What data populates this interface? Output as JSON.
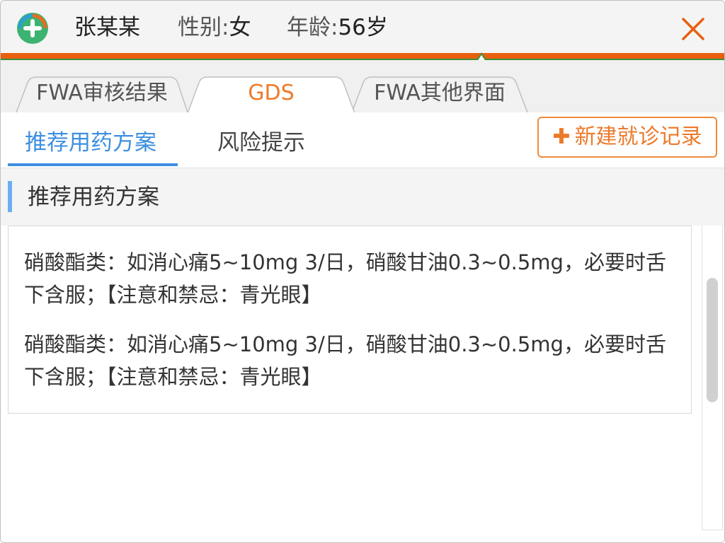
{
  "header": {
    "patient_name": "张某某",
    "gender_label": "性别:",
    "gender_value": "女",
    "age_label": "年龄:",
    "age_value": "56岁",
    "logo_icon": "app-logo-icon",
    "close_icon": "close-icon"
  },
  "colors": {
    "accent_orange": "#e8600f",
    "active_tab_blue": "#3d8fe0",
    "button_orange": "#ec7a2b"
  },
  "tabs": [
    {
      "label": "FWA审核结果",
      "active": false
    },
    {
      "label": "GDS",
      "active": true
    },
    {
      "label": "FWA其他界面",
      "active": false
    }
  ],
  "subtabs": [
    {
      "label": "推荐用药方案",
      "active": true
    },
    {
      "label": "风险提示",
      "active": false
    }
  ],
  "actions": {
    "new_record_label": "新建就诊记录",
    "new_record_icon": "plus-icon"
  },
  "section": {
    "title": "推荐用药方案"
  },
  "content": {
    "items": [
      "硝酸酯类：如消心痛5~10mg 3/日，硝酸甘油0.3~0.5mg，必要时舌下含服；【注意和禁忌：青光眼】",
      "硝酸酯类：如消心痛5~10mg 3/日，硝酸甘油0.3~0.5mg，必要时舌下含服；【注意和禁忌：青光眼】"
    ]
  }
}
